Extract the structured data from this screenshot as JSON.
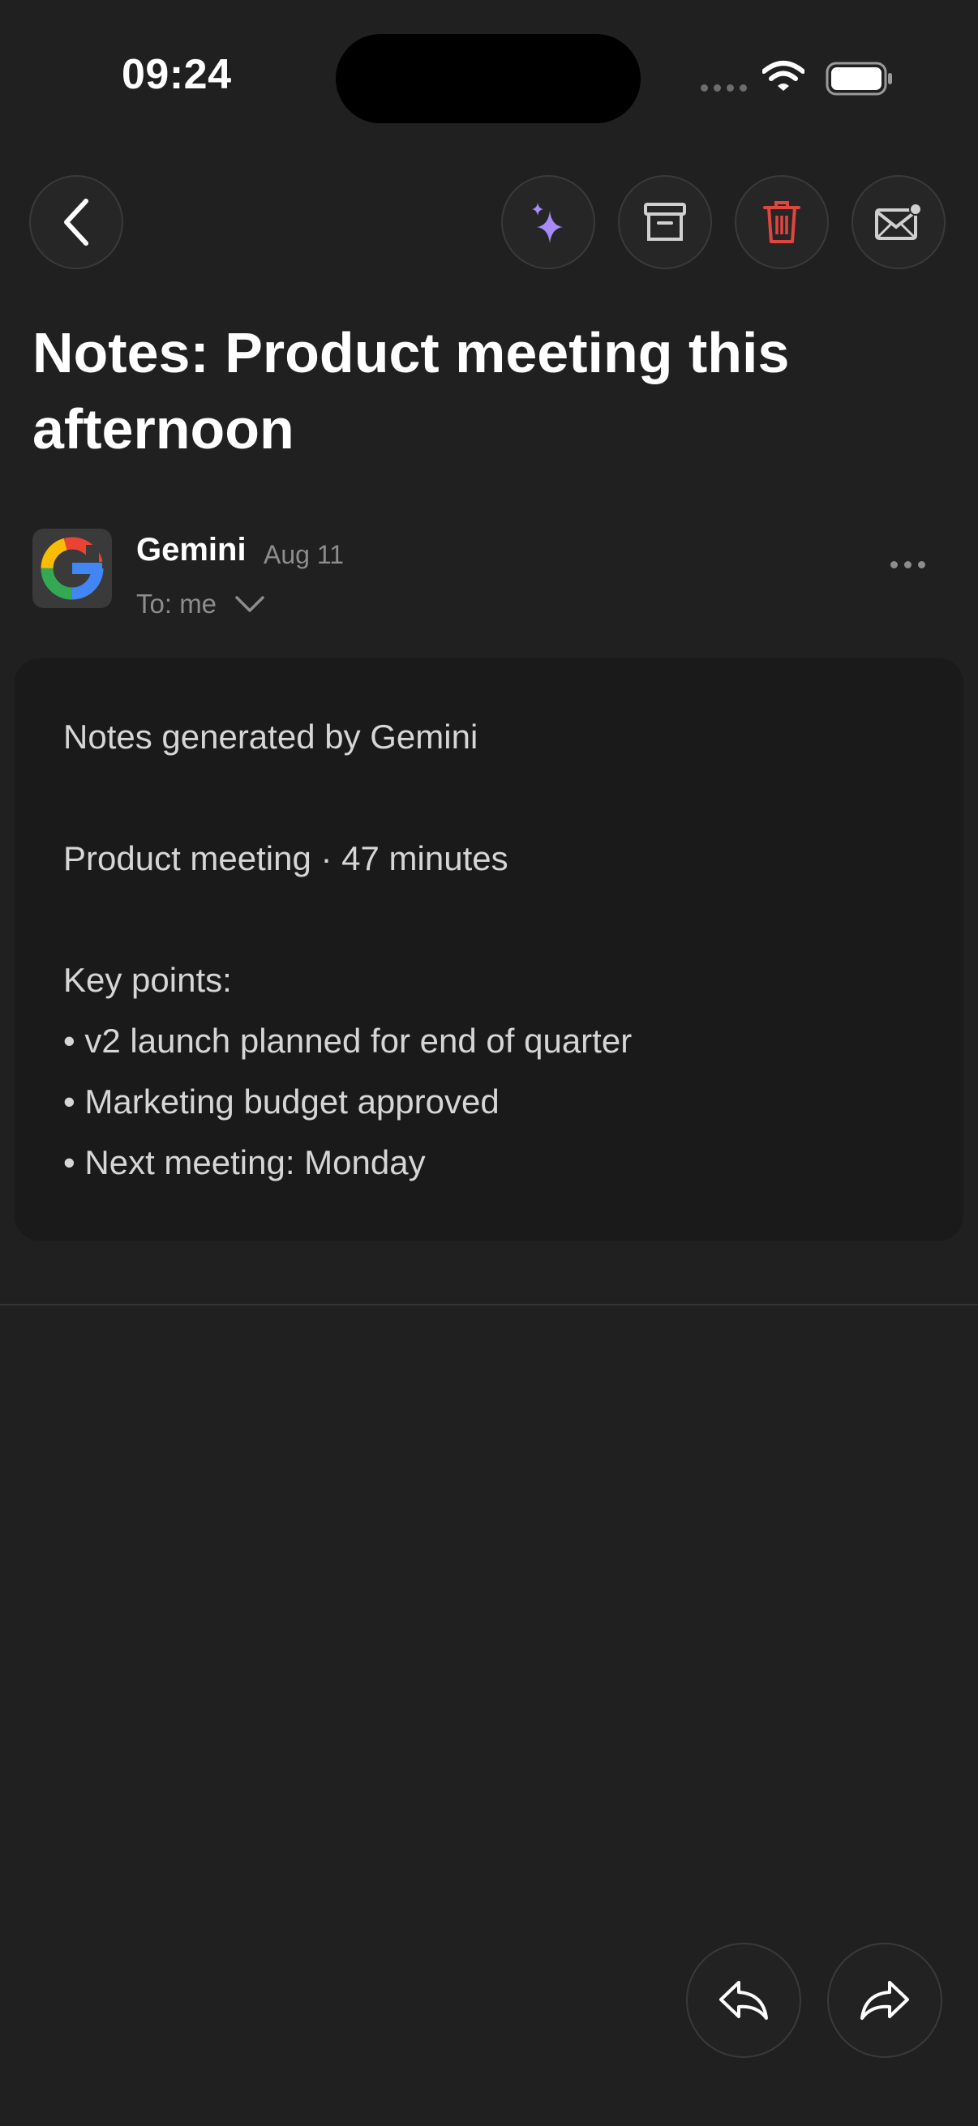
{
  "status_bar": {
    "time": "09:24"
  },
  "toolbar": {
    "back_icon": "chevron-left-icon",
    "actions": [
      {
        "name": "ai-summary-button",
        "icon": "sparkle-icon",
        "color": "#a78bfa"
      },
      {
        "name": "archive-button",
        "icon": "archive-icon",
        "color": "#d0d0d0"
      },
      {
        "name": "delete-button",
        "icon": "trash-icon",
        "color": "#e0463d"
      },
      {
        "name": "mark-unread-button",
        "icon": "envelope-dot-icon",
        "color": "#d0d0d0"
      }
    ]
  },
  "email": {
    "subject": "Notes: Product meeting this afternoon",
    "sender": "Gemini",
    "date": "Aug 11",
    "to": "To: me",
    "body": {
      "line1": "Notes generated by Gemini",
      "line2": "Product meeting · 47 minutes",
      "key_points_label": "Key points:",
      "points": [
        "• v2 launch planned for end of quarter",
        "• Marketing budget approved",
        "• Next meeting: Monday"
      ]
    }
  },
  "footer": {
    "reply_icon": "reply-icon",
    "forward_icon": "forward-icon"
  },
  "colors": {
    "background": "#202020",
    "card": "#1a1a1a",
    "muted_text": "#8d8d8d",
    "sparkle": "#a78bfa",
    "trash": "#e0463d"
  }
}
